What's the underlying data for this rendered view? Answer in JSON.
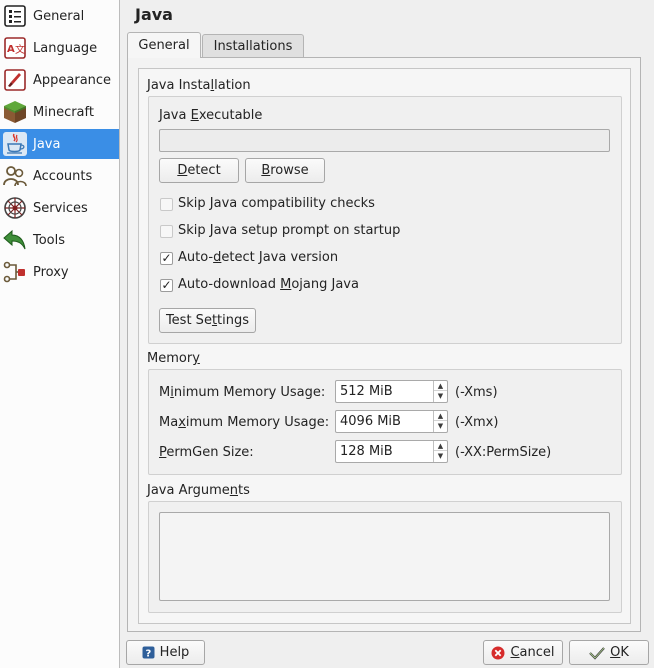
{
  "colors": {
    "selection": "#3a8ee6",
    "window_bg": "#efefef",
    "sidebar_bg": "#fcfcfc"
  },
  "sidebar": {
    "items": [
      {
        "label": "General",
        "icon": "settings-list-icon"
      },
      {
        "label": "Language",
        "icon": "language-icon"
      },
      {
        "label": "Appearance",
        "icon": "appearance-brush-icon"
      },
      {
        "label": "Minecraft",
        "icon": "minecraft-grass-block-icon"
      },
      {
        "label": "Java",
        "icon": "java-coffee-cup-icon",
        "selected": true
      },
      {
        "label": "Accounts",
        "icon": "accounts-people-icon"
      },
      {
        "label": "Services",
        "icon": "services-icon"
      },
      {
        "label": "Tools",
        "icon": "tools-arrow-icon"
      },
      {
        "label": "Proxy",
        "icon": "proxy-icon"
      }
    ]
  },
  "header": {
    "title": "Java"
  },
  "tabs": [
    {
      "label": "General",
      "active": true
    },
    {
      "label": "Installations",
      "active": false
    }
  ],
  "java_installation": {
    "title_pre": "Java Insta",
    "title_key": "l",
    "title_post": "lation",
    "executable_label_pre": "Java ",
    "executable_label_key": "E",
    "executable_label_post": "xecutable",
    "executable_value": "",
    "detect_pre": "",
    "detect_key": "D",
    "detect_post": "etect",
    "browse_pre": "",
    "browse_key": "B",
    "browse_post": "rowse",
    "checkboxes": [
      {
        "pre": "Skip Java compatibility checks",
        "key": "",
        "post": "",
        "checked": false
      },
      {
        "pre": "Skip Java setup prompt on startup",
        "key": "",
        "post": "",
        "checked": false
      },
      {
        "pre": "Auto-",
        "key": "d",
        "post": "etect Java version",
        "checked": true
      },
      {
        "pre": "Auto-download ",
        "key": "M",
        "post": "ojang Java",
        "checked": true
      }
    ],
    "test_pre": "Test Se",
    "test_key": "t",
    "test_post": "tings"
  },
  "memory": {
    "title_pre": "Memor",
    "title_key": "y",
    "title_post": "",
    "rows": [
      {
        "pre": "M",
        "key": "i",
        "post": "nimum Memory Usage:",
        "value": "512 MiB",
        "suffix": "(-Xms)"
      },
      {
        "pre": "Ma",
        "key": "x",
        "post": "imum Memory Usage:",
        "value": "4096 MiB",
        "suffix": "(-Xmx)"
      },
      {
        "pre": "",
        "key": "P",
        "post": "ermGen Size:",
        "value": "128 MiB",
        "suffix": "(-XX:PermSize)"
      }
    ]
  },
  "java_arguments": {
    "title_pre": "Java Argume",
    "title_key": "n",
    "title_post": "ts",
    "value": ""
  },
  "footer": {
    "help_label": "Help",
    "cancel_pre": "",
    "cancel_key": "C",
    "cancel_post": "ancel",
    "ok_pre": "",
    "ok_key": "O",
    "ok_post": "K"
  }
}
